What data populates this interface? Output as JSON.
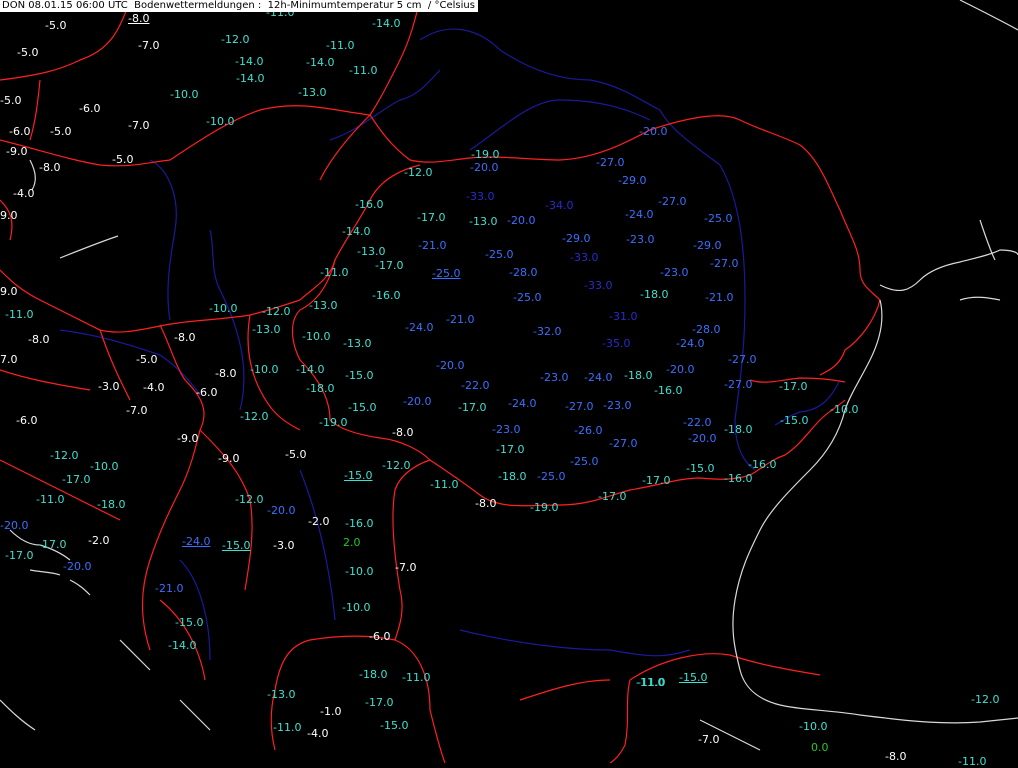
{
  "header": {
    "station": "DON",
    "datetime": "08.01.15 06:00 UTC",
    "title": "Bodenwettermeldungen :  12h-Minimumtemperatur 5 cm  / °Celsius"
  },
  "colors": {
    "background": "#000000",
    "border_lines": "#ff2020",
    "river_lines": "#1a1a9a",
    "coast_lines": "#d8d8d8",
    "temp_white": "#ffffff",
    "temp_cyan": "#40e0d0",
    "temp_blue": "#3a70ff",
    "temp_darkblue": "#2a2ad0",
    "temp_green": "#22cc22"
  },
  "observations": [
    {
      "v": "-8.0",
      "c": "w",
      "u": true
    },
    {
      "v": "-11.0",
      "c": "c"
    },
    {
      "v": "-14.0",
      "c": "c"
    },
    {
      "v": "-5.0",
      "c": "w"
    },
    {
      "v": "-7.0",
      "c": "w"
    },
    {
      "v": "-12.0",
      "c": "c"
    },
    {
      "v": "-11.0",
      "c": "c"
    },
    {
      "v": "-5.0",
      "c": "w"
    },
    {
      "v": "-14.0",
      "c": "c"
    },
    {
      "v": "-14.0",
      "c": "c"
    },
    {
      "v": "-11.0",
      "c": "c"
    },
    {
      "v": "-14.0",
      "c": "c"
    },
    {
      "v": "-10.0",
      "c": "c"
    },
    {
      "v": "-13.0",
      "c": "c"
    },
    {
      "v": "-5.0",
      "c": "w"
    },
    {
      "v": "-6.0",
      "c": "w"
    },
    {
      "v": "-10.0",
      "c": "c"
    },
    {
      "v": "-7.0",
      "c": "w"
    },
    {
      "v": "-6.0",
      "c": "w"
    },
    {
      "v": "-5.0",
      "c": "w"
    },
    {
      "v": "-20.0",
      "c": "b"
    },
    {
      "v": "-9.0",
      "c": "w"
    },
    {
      "v": "-5.0",
      "c": "w"
    },
    {
      "v": "-19.0",
      "c": "c"
    },
    {
      "v": "-20.0",
      "c": "b"
    },
    {
      "v": "-27.0",
      "c": "b"
    },
    {
      "v": "-8.0",
      "c": "w"
    },
    {
      "v": "-12.0",
      "c": "c"
    },
    {
      "v": "-29.0",
      "c": "b"
    },
    {
      "v": "-4.0",
      "c": "w"
    },
    {
      "v": "-33.0",
      "c": "d"
    },
    {
      "v": "-16.0",
      "c": "c"
    },
    {
      "v": "-34.0",
      "c": "d"
    },
    {
      "v": "-27.0",
      "c": "b"
    },
    {
      "v": "9.0",
      "c": "w"
    },
    {
      "v": "-17.0",
      "c": "c"
    },
    {
      "v": "-13.0",
      "c": "c"
    },
    {
      "v": "-20.0",
      "c": "b"
    },
    {
      "v": "-24.0",
      "c": "b"
    },
    {
      "v": "-25.0",
      "c": "b"
    },
    {
      "v": "-14.0",
      "c": "c"
    },
    {
      "v": "-29.0",
      "c": "b"
    },
    {
      "v": "-23.0",
      "c": "b"
    },
    {
      "v": "-21.0",
      "c": "b"
    },
    {
      "v": "-29.0",
      "c": "b"
    },
    {
      "v": "-13.0",
      "c": "c"
    },
    {
      "v": "-25.0",
      "c": "b"
    },
    {
      "v": "-33.0",
      "c": "d"
    },
    {
      "v": "-17.0",
      "c": "c"
    },
    {
      "v": "-27.0",
      "c": "b"
    },
    {
      "v": "-11.0",
      "c": "c"
    },
    {
      "v": "-25.0",
      "c": "b",
      "u": true
    },
    {
      "v": "-28.0",
      "c": "b"
    },
    {
      "v": "-23.0",
      "c": "b"
    },
    {
      "v": "-33.0",
      "c": "d"
    },
    {
      "v": "9.0",
      "c": "w"
    },
    {
      "v": "-16.0",
      "c": "c"
    },
    {
      "v": "-25.0",
      "c": "b"
    },
    {
      "v": "-18.0",
      "c": "c"
    },
    {
      "v": "-21.0",
      "c": "b"
    },
    {
      "v": "-10.0",
      "c": "c"
    },
    {
      "v": "-12.0",
      "c": "c"
    },
    {
      "v": "-13.0",
      "c": "c"
    },
    {
      "v": "-11.0",
      "c": "c"
    },
    {
      "v": "-21.0",
      "c": "b"
    },
    {
      "v": "-31.0",
      "c": "d"
    },
    {
      "v": "-13.0",
      "c": "c"
    },
    {
      "v": "-24.0",
      "c": "b"
    },
    {
      "v": "-28.0",
      "c": "b"
    },
    {
      "v": "-8.0",
      "c": "w"
    },
    {
      "v": "-10.0",
      "c": "c"
    },
    {
      "v": "-32.0",
      "c": "b"
    },
    {
      "v": "-8.0",
      "c": "w"
    },
    {
      "v": "-13.0",
      "c": "c"
    },
    {
      "v": "-35.0",
      "c": "d"
    },
    {
      "v": "-24.0",
      "c": "b"
    },
    {
      "v": "7.0",
      "c": "w"
    },
    {
      "v": "-5.0",
      "c": "w"
    },
    {
      "v": "-27.0",
      "c": "b"
    },
    {
      "v": "-20.0",
      "c": "b"
    },
    {
      "v": "-8.0",
      "c": "w"
    },
    {
      "v": "-10.0",
      "c": "c"
    },
    {
      "v": "-14.0",
      "c": "c"
    },
    {
      "v": "-15.0",
      "c": "c"
    },
    {
      "v": "-23.0",
      "c": "b"
    },
    {
      "v": "-24.0",
      "c": "b"
    },
    {
      "v": "-18.0",
      "c": "c"
    },
    {
      "v": "-20.0",
      "c": "b"
    },
    {
      "v": "-3.0",
      "c": "w"
    },
    {
      "v": "-4.0",
      "c": "w"
    },
    {
      "v": "-22.0",
      "c": "b"
    },
    {
      "v": "-27.0",
      "c": "b"
    },
    {
      "v": "-17.0",
      "c": "c"
    },
    {
      "v": "-6.0",
      "c": "w"
    },
    {
      "v": "-18.0",
      "c": "c"
    },
    {
      "v": "-16.0",
      "c": "c"
    },
    {
      "v": "-7.0",
      "c": "w"
    },
    {
      "v": "-15.0",
      "c": "c"
    },
    {
      "v": "-20.0",
      "c": "b"
    },
    {
      "v": "-17.0",
      "c": "c"
    },
    {
      "v": "-24.0",
      "c": "b"
    },
    {
      "v": "-27.0",
      "c": "b"
    },
    {
      "v": "-23.0",
      "c": "b"
    },
    {
      "v": "-10.0",
      "c": "c"
    },
    {
      "v": "-12.0",
      "c": "c"
    },
    {
      "v": "-6.0",
      "c": "w"
    },
    {
      "v": "-19.0",
      "c": "c"
    },
    {
      "v": "-15.0",
      "c": "c"
    },
    {
      "v": "-22.0",
      "c": "b"
    },
    {
      "v": "-8.0",
      "c": "w"
    },
    {
      "v": "-23.0",
      "c": "b"
    },
    {
      "v": "-26.0",
      "c": "b"
    },
    {
      "v": "-18.0",
      "c": "c"
    },
    {
      "v": "-9.0",
      "c": "w"
    },
    {
      "v": "-20.0",
      "c": "b"
    },
    {
      "v": "-27.0",
      "c": "b"
    },
    {
      "v": "-17.0",
      "c": "c"
    },
    {
      "v": "-12.0",
      "c": "c"
    },
    {
      "v": "-9.0",
      "c": "w"
    },
    {
      "v": "-5.0",
      "c": "w"
    },
    {
      "v": "-16.0",
      "c": "c"
    },
    {
      "v": "-10.0",
      "c": "c"
    },
    {
      "v": "-12.0",
      "c": "c"
    },
    {
      "v": "-25.0",
      "c": "b"
    },
    {
      "v": "-15.0",
      "c": "c"
    },
    {
      "v": "-17.0",
      "c": "c"
    },
    {
      "v": "-15.0",
      "c": "c",
      "u": true
    },
    {
      "v": "-16.0",
      "c": "c"
    },
    {
      "v": "-11.0",
      "c": "c"
    },
    {
      "v": "-18.0",
      "c": "c"
    },
    {
      "v": "-25.0",
      "c": "b"
    },
    {
      "v": "-17.0",
      "c": "c"
    },
    {
      "v": "-11.0",
      "c": "c"
    },
    {
      "v": "-8.0",
      "c": "w"
    },
    {
      "v": "-17.0",
      "c": "c"
    },
    {
      "v": "-19.0",
      "c": "c"
    },
    {
      "v": "-18.0",
      "c": "c"
    },
    {
      "v": "-20.0",
      "c": "b"
    },
    {
      "v": "-16.0",
      "c": "c"
    },
    {
      "v": "-12.0",
      "c": "c"
    },
    {
      "v": "-2.0",
      "c": "w"
    },
    {
      "v": "-20.0",
      "c": "b"
    },
    {
      "v": "-24.0",
      "c": "b",
      "u": true
    },
    {
      "v": "-15.0",
      "c": "c",
      "u": true
    },
    {
      "v": "-3.0",
      "c": "w"
    },
    {
      "v": "-2.0",
      "c": "w"
    },
    {
      "v": "-17.0",
      "c": "c"
    },
    {
      "v": "2.0",
      "c": "g"
    },
    {
      "v": "-17.0",
      "c": "c"
    },
    {
      "v": "-7.0",
      "c": "w"
    },
    {
      "v": "-20.0",
      "c": "b"
    },
    {
      "v": "-10.0",
      "c": "c"
    },
    {
      "v": "-21.0",
      "c": "b"
    },
    {
      "v": "-10.0",
      "c": "c"
    },
    {
      "v": "-15.0",
      "c": "c"
    },
    {
      "v": "-6.0",
      "c": "w"
    },
    {
      "v": "-14.0",
      "c": "c"
    },
    {
      "v": "-18.0",
      "c": "c"
    },
    {
      "v": "-11.0",
      "c": "c"
    },
    {
      "v": "-11.0",
      "c": "c"
    },
    {
      "v": "-15.0",
      "c": "c",
      "u": true
    },
    {
      "v": "-13.0",
      "c": "c"
    },
    {
      "v": "-17.0",
      "c": "c"
    },
    {
      "v": "-1.0",
      "c": "w"
    },
    {
      "v": "-12.0",
      "c": "c"
    },
    {
      "v": "-11.0",
      "c": "c"
    },
    {
      "v": "-15.0",
      "c": "c"
    },
    {
      "v": "-4.0",
      "c": "w"
    },
    {
      "v": "-10.0",
      "c": "c"
    },
    {
      "v": "-7.0",
      "c": "w"
    },
    {
      "v": "0.0",
      "c": "g"
    },
    {
      "v": "-8.0",
      "c": "w"
    },
    {
      "v": "-11.0",
      "c": "c"
    },
    {
      "v": "-11.0",
      "c": "c"
    }
  ]
}
